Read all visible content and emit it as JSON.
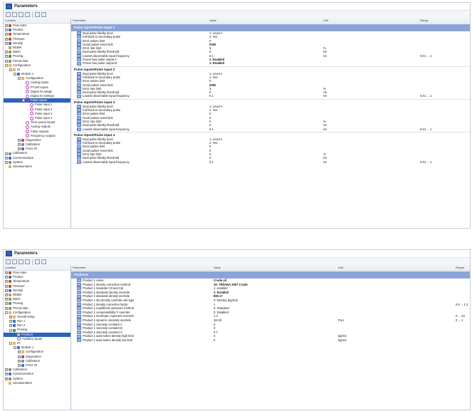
{
  "window1": {
    "title": "Parameters",
    "col_headers": {
      "location": "Location",
      "parameter": "Parameter",
      "value": "Value",
      "unit": "Unit",
      "range": "Range"
    },
    "tree": [
      {
        "label": "Flow rates",
        "level": 0,
        "exp": "+",
        "icon": "orange"
      },
      {
        "label": "Product",
        "level": 0,
        "exp": "+",
        "icon": "blue"
      },
      {
        "label": "Temperature",
        "level": 0,
        "exp": "+",
        "icon": "orange"
      },
      {
        "label": "Pressure",
        "level": 0,
        "exp": "+",
        "icon": "orange"
      },
      {
        "label": "Density",
        "level": 0,
        "exp": "+",
        "icon": "blue"
      },
      {
        "label": "BS&W",
        "level": 0,
        "exp": "",
        "icon": "gold"
      },
      {
        "label": "Batch",
        "level": 0,
        "exp": "+",
        "icon": "gray"
      },
      {
        "label": "Proving",
        "level": 0,
        "exp": "+",
        "icon": "green"
      },
      {
        "label": "Period data",
        "level": 0,
        "exp": "+",
        "icon": "gray"
      },
      {
        "label": "Configuration",
        "level": 0,
        "exp": "-",
        "icon": "folder"
      },
      {
        "label": "IO",
        "level": 1,
        "exp": "-",
        "icon": "folder"
      },
      {
        "label": "Module 1",
        "level": 2,
        "exp": "-",
        "icon": "blue"
      },
      {
        "label": "Configuration",
        "level": 3,
        "exp": "-",
        "icon": "folder"
      },
      {
        "label": "Analog inputs",
        "level": 4,
        "exp": "",
        "icon": "pulse"
      },
      {
        "label": "PT100 inputs",
        "level": 4,
        "exp": "",
        "icon": "pulse"
      },
      {
        "label": "Digital IO assign",
        "level": 4,
        "exp": "",
        "icon": "pulse"
      },
      {
        "label": "Digital IO settings",
        "level": 4,
        "exp": "",
        "icon": "pulse"
      },
      {
        "label": "Pulse inputs",
        "level": 4,
        "exp": "-",
        "icon": "pulse",
        "selected": true
      },
      {
        "label": "Pulse input 1",
        "level": 5,
        "exp": "",
        "icon": "pulse"
      },
      {
        "label": "Pulse input 2",
        "level": 5,
        "exp": "",
        "icon": "pulse"
      },
      {
        "label": "Pulse input 3",
        "level": 5,
        "exp": "",
        "icon": "pulse"
      },
      {
        "label": "Pulse input 4",
        "level": 5,
        "exp": "",
        "icon": "pulse"
      },
      {
        "label": "Time period inputs",
        "level": 4,
        "exp": "",
        "icon": "pulse"
      },
      {
        "label": "Analog outputs",
        "level": 4,
        "exp": "",
        "icon": "pulse"
      },
      {
        "label": "Pulse outputs",
        "level": 4,
        "exp": "",
        "icon": "pulse"
      },
      {
        "label": "Frequency outputs",
        "level": 4,
        "exp": "",
        "icon": "pulse"
      },
      {
        "label": "Diagnostics",
        "level": 3,
        "exp": "+",
        "icon": "purple"
      },
      {
        "label": "Calibration",
        "level": 3,
        "exp": "+",
        "icon": "gray"
      },
      {
        "label": "Force IO",
        "level": 3,
        "exp": "+",
        "icon": "blue"
      },
      {
        "label": "Calibration",
        "level": 0,
        "exp": "+",
        "icon": "gray"
      },
      {
        "label": "Communication",
        "level": 0,
        "exp": "+",
        "icon": "blue"
      },
      {
        "label": "System",
        "level": 0,
        "exp": "+",
        "icon": "gray"
      },
      {
        "label": "Serialnumbers",
        "level": 0,
        "exp": "",
        "icon": "folder"
      }
    ],
    "sections": [
      {
        "title": "Pulse inputs\\Pulse input 1",
        "style": "highlight",
        "rows": [
          {
            "p": "Dual pulse fidelity level",
            "v": "1: Level A",
            "u": "",
            "r": ""
          },
          {
            "p": "Fall back to secondary pulse",
            "v": "1: Yes",
            "u": "",
            "r": ""
          },
          {
            "p": "Error pulses limit",
            "v": "0",
            "u": "",
            "r": ""
          },
          {
            "p": "Good pulses reset limit",
            "v": "2000",
            "u": "",
            "r": "",
            "bold": true
          },
          {
            "p": "Error rate limit",
            "v": "1",
            "u": "%",
            "r": "",
            "bold": true
          },
          {
            "p": "Dual pulse fidelity threshold",
            "v": "0",
            "u": "Hz",
            "r": ""
          },
          {
            "p": "Lowest discernable input frequency",
            "v": "0.1",
            "u": "Hz",
            "r": "0.01 ... 1"
          },
          {
            "p": "Prover bus pulse output A",
            "v": "1: Enabled",
            "u": "",
            "r": "",
            "bold": true
          },
          {
            "p": "Prover bus pulse output B",
            "v": "1: Enabled",
            "u": "",
            "r": "",
            "bold": true
          }
        ]
      },
      {
        "title": "Pulse inputs\\Pulse input 2",
        "style": "plain",
        "rows": [
          {
            "p": "Dual pulse fidelity level",
            "v": "1: Level A",
            "u": "",
            "r": ""
          },
          {
            "p": "Fall back to secondary pulse",
            "v": "1: Yes",
            "u": "",
            "r": ""
          },
          {
            "p": "Error pulses limit",
            "v": "0",
            "u": "",
            "r": ""
          },
          {
            "p": "Good pulses reset limit",
            "v": "2000",
            "u": "",
            "r": "",
            "bold": true
          },
          {
            "p": "Error rate limit",
            "v": "1",
            "u": "%",
            "r": "",
            "bold": true
          },
          {
            "p": "Dual pulse fidelity threshold",
            "v": "0",
            "u": "Hz",
            "r": ""
          },
          {
            "p": "Lowest discernable input frequency",
            "v": "0.1",
            "u": "Hz",
            "r": "0.01 ... 1"
          }
        ]
      },
      {
        "title": "Pulse inputs\\Pulse input 3",
        "style": "plain",
        "rows": [
          {
            "p": "Dual pulse fidelity level",
            "v": "1: Level A",
            "u": "",
            "r": ""
          },
          {
            "p": "Fall back to secondary pulse",
            "v": "1: Yes",
            "u": "",
            "r": ""
          },
          {
            "p": "Error pulses limit",
            "v": "0",
            "u": "",
            "r": ""
          },
          {
            "p": "Good pulses reset limit",
            "v": "0",
            "u": "",
            "r": ""
          },
          {
            "p": "Error rate limit",
            "v": "0",
            "u": "%",
            "r": ""
          },
          {
            "p": "Dual pulse fidelity threshold",
            "v": "0",
            "u": "Hz",
            "r": ""
          },
          {
            "p": "Lowest discernable input frequency",
            "v": "0.1",
            "u": "Hz",
            "r": "0.01 ... 1"
          }
        ]
      },
      {
        "title": "Pulse inputs\\Pulse input 4",
        "style": "plain",
        "rows": [
          {
            "p": "Dual pulse fidelity level",
            "v": "1: Level A",
            "u": "",
            "r": ""
          },
          {
            "p": "Fall back to secondary pulse",
            "v": "1: Yes",
            "u": "",
            "r": ""
          },
          {
            "p": "Error pulses limit",
            "v": "0",
            "u": "",
            "r": ""
          },
          {
            "p": "Good pulses reset limit",
            "v": "0",
            "u": "",
            "r": ""
          },
          {
            "p": "Error rate limit",
            "v": "0",
            "u": "%",
            "r": ""
          },
          {
            "p": "Dual pulse fidelity threshold",
            "v": "0",
            "u": "Hz",
            "r": ""
          },
          {
            "p": "Lowest discernable input frequency",
            "v": "0.1",
            "u": "Hz",
            "r": "0.01 ... 1"
          }
        ]
      }
    ]
  },
  "window2": {
    "title": "Parameters",
    "col_headers": {
      "location": "Location",
      "parameter": "Parameter",
      "value": "Value",
      "unit": "Unit",
      "range": "Range"
    },
    "tree": [
      {
        "label": "Flow rates",
        "level": 0,
        "exp": "+",
        "icon": "orange"
      },
      {
        "label": "Product",
        "level": 0,
        "exp": "+",
        "icon": "blue"
      },
      {
        "label": "Temperature",
        "level": 0,
        "exp": "+",
        "icon": "orange"
      },
      {
        "label": "Pressure",
        "level": 0,
        "exp": "+",
        "icon": "orange"
      },
      {
        "label": "Density",
        "level": 0,
        "exp": "+",
        "icon": "blue"
      },
      {
        "label": "BS&W",
        "level": 0,
        "exp": "+",
        "icon": "gold"
      },
      {
        "label": "Batch",
        "level": 0,
        "exp": "+",
        "icon": "gray"
      },
      {
        "label": "Proving",
        "level": 0,
        "exp": "+",
        "icon": "green"
      },
      {
        "label": "Period data",
        "level": 0,
        "exp": "+",
        "icon": "gray"
      },
      {
        "label": "Configuration",
        "level": 0,
        "exp": "-",
        "icon": "folder"
      },
      {
        "label": "Overall setup",
        "level": 1,
        "exp": "+",
        "icon": "folder"
      },
      {
        "label": "Run 1",
        "level": 1,
        "exp": "+",
        "icon": "blue"
      },
      {
        "label": "Run 2",
        "level": 1,
        "exp": "+",
        "icon": "blue"
      },
      {
        "label": "Proving",
        "level": 1,
        "exp": "-",
        "icon": "green"
      },
      {
        "label": "Products",
        "level": 2,
        "exp": "",
        "icon": "folder",
        "selected": true
      },
      {
        "label": "Auxiliary inputs",
        "level": 2,
        "exp": "",
        "icon": "pulse"
      },
      {
        "label": "IO",
        "level": 1,
        "exp": "-",
        "icon": "folder"
      },
      {
        "label": "Module 1",
        "level": 2,
        "exp": "-",
        "icon": "blue"
      },
      {
        "label": "Configuration",
        "level": 3,
        "exp": "+",
        "icon": "folder"
      },
      {
        "label": "Diagnostics",
        "level": 3,
        "exp": "+",
        "icon": "purple"
      },
      {
        "label": "Calibration",
        "level": 3,
        "exp": "+",
        "icon": "gray"
      },
      {
        "label": "Force IO",
        "level": 3,
        "exp": "+",
        "icon": "blue"
      },
      {
        "label": "Calibration",
        "level": 0,
        "exp": "+",
        "icon": "gray"
      },
      {
        "label": "Communication",
        "level": 0,
        "exp": "+",
        "icon": "blue"
      },
      {
        "label": "System",
        "level": 0,
        "exp": "+",
        "icon": "gray"
      },
      {
        "label": "Serialnumbers",
        "level": 0,
        "exp": "",
        "icon": "folder"
      }
    ],
    "sections": [
      {
        "title": "Products",
        "style": "highlight",
        "rows": [
          {
            "p": "Product 1 name",
            "v": "Crude oil",
            "u": "",
            "r": "",
            "bold": true
          },
          {
            "p": "Product 1 density correction method",
            "v": "15: TR/IAHA 2007 Crude",
            "u": "",
            "r": "",
            "bold": true
          },
          {
            "p": "Product 1 separate Ctl and Cpl",
            "v": "1: enabled",
            "u": "",
            "r": ""
          },
          {
            "p": "Product 1 standard density override",
            "v": "1: Enabled",
            "u": "",
            "r": "",
            "bold": true
          },
          {
            "p": "Product 1 standard density override",
            "v": "800.17",
            "u": "",
            "r": "",
            "bold": true
          },
          {
            "p": "Product 1 std density override unit type",
            "v": "0: Density (kg/m3)",
            "u": "",
            "r": ""
          },
          {
            "p": "Product 1 density correction factor",
            "v": "1",
            "u": "",
            "r": "0.8 ... 1.2"
          },
          {
            "p": "Product 1 equilibrium pressure method",
            "v": "0: Standard",
            "u": "",
            "r": ""
          },
          {
            "p": "Product 1 compressibility F override",
            "v": "0: Disabled",
            "u": "",
            "r": ""
          },
          {
            "p": "Product 1 Isentropic exponent override",
            "v": "1.3",
            "u": "",
            "r": "0 ... 10"
          },
          {
            "p": "Product 1 dynamic viscosity override",
            "v": "1E-03",
            "u": "Pa.s",
            "r": "0 ... 1"
          },
          {
            "p": "Product 1 viscosity constant A",
            "v": "0",
            "u": "",
            "r": ""
          },
          {
            "p": "Product 1 viscosity constant B",
            "v": "0",
            "u": "",
            "r": ""
          },
          {
            "p": "Product 1 viscosity constant C",
            "v": "0.7",
            "u": "",
            "r": ""
          },
          {
            "p": "Product 1 auto-select density high limit",
            "v": "0",
            "u": "kg/m3",
            "r": ""
          },
          {
            "p": "Product 1 auto-select density low limit",
            "v": "0",
            "u": "kg/m3",
            "r": ""
          }
        ]
      }
    ]
  }
}
